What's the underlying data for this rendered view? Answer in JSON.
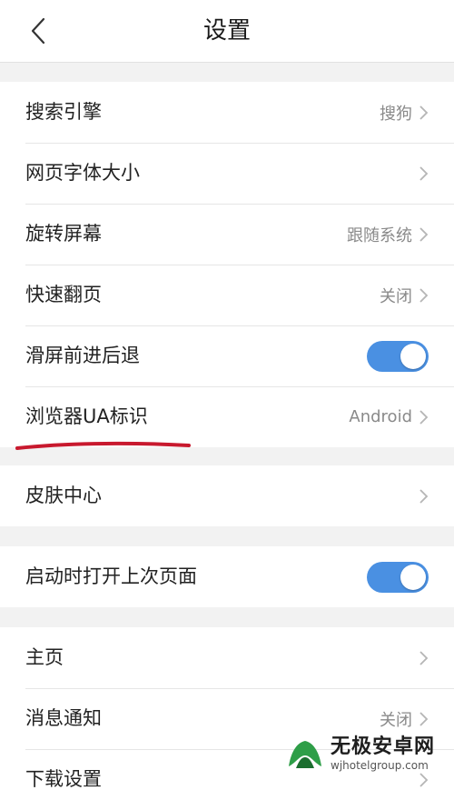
{
  "header": {
    "title": "设置",
    "back_icon": "chevron-left-icon"
  },
  "groups": [
    {
      "rows": [
        {
          "label": "搜索引擎",
          "value": "搜狗"
        },
        {
          "label": "网页字体大小",
          "value": ""
        },
        {
          "label": "旋转屏幕",
          "value": "跟随系统"
        },
        {
          "label": "快速翻页",
          "value": "关闭"
        },
        {
          "label": "滑屏前进后退",
          "toggle_on": true
        },
        {
          "label": "浏览器UA标识",
          "value": "Android"
        }
      ]
    },
    {
      "rows": [
        {
          "label": "皮肤中心",
          "value": ""
        }
      ]
    },
    {
      "rows": [
        {
          "label": "启动时打开上次页面",
          "toggle_on": true
        }
      ]
    },
    {
      "rows": [
        {
          "label": "主页",
          "value": ""
        },
        {
          "label": "消息通知",
          "value": "关闭"
        },
        {
          "label": "下载设置",
          "value": ""
        }
      ]
    }
  ],
  "watermark": {
    "name": "无极安卓网",
    "url": "wjhotelgroup.com"
  },
  "colors": {
    "toggle_on": "#4a90e2",
    "annotation_underline": "#c8192e",
    "background": "#f2f2f2"
  }
}
